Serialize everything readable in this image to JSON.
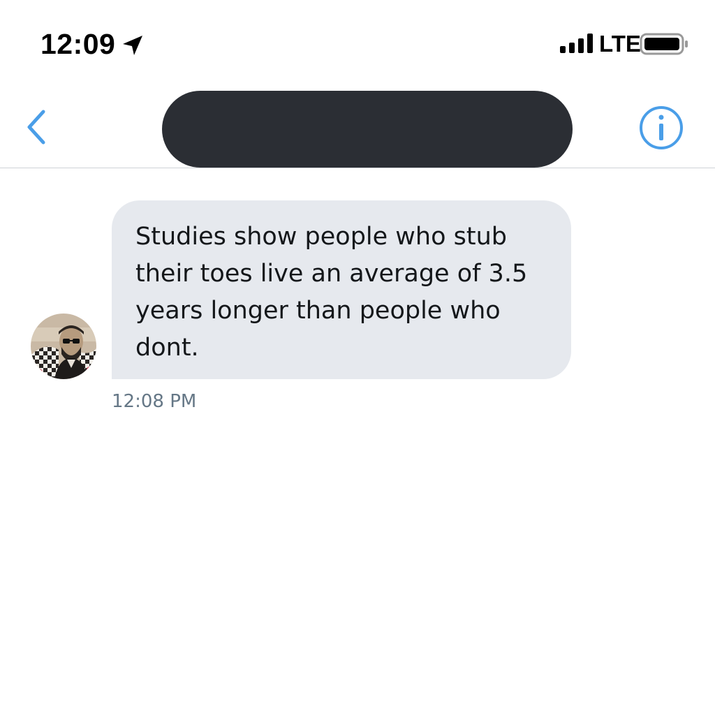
{
  "status_bar": {
    "time": "12:09",
    "network": "LTE",
    "icons": [
      "location-arrow-icon",
      "cellular-signal-icon",
      "battery-icon"
    ]
  },
  "header": {
    "back_icon": "chevron-left-icon",
    "contact_name": "",
    "contact_name_redacted": true,
    "info_icon": "info-circle-icon",
    "accent_color": "#4a9ee8"
  },
  "conversation": {
    "messages": [
      {
        "direction": "incoming",
        "text": "Studies show people who stub their toes live an average of 3.5 years longer than people who dont.",
        "timestamp": "12:08 PM",
        "avatar": "sender-avatar"
      }
    ],
    "bubble_color": "#e6e9ee",
    "timestamp_color": "#657786"
  }
}
